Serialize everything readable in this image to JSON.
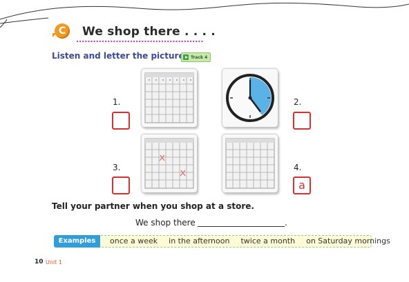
{
  "section": {
    "badge": "C",
    "title": "We shop there . . . .",
    "colors": {
      "badge": "#f39a1e",
      "instruction": "#3a4a9a",
      "answer_box": "#d63030",
      "examples_label": "#2f9fd9"
    }
  },
  "instruction": "Listen and letter the pictures.",
  "track": {
    "label": "Track 4",
    "icon": "play-icon"
  },
  "items": [
    {
      "number": "1.",
      "answer": "",
      "picture": "calendar-icon"
    },
    {
      "number": "2.",
      "answer": "",
      "picture": "clock-icon"
    },
    {
      "number": "3.",
      "answer": "",
      "picture": "calendar-marked-icon"
    },
    {
      "number": "4.",
      "answer": "a",
      "picture": "calendar-icon"
    }
  ],
  "partner_instruction": "Tell your partner when you shop at a store.",
  "prompt": {
    "text": "We shop there",
    "end": "."
  },
  "examples": {
    "label": "Examples",
    "items": [
      "once a week",
      "in the afternoon",
      "twice a month",
      "on Saturday mornings"
    ]
  },
  "footer": {
    "page_number": "10",
    "unit": "Unit 1"
  }
}
